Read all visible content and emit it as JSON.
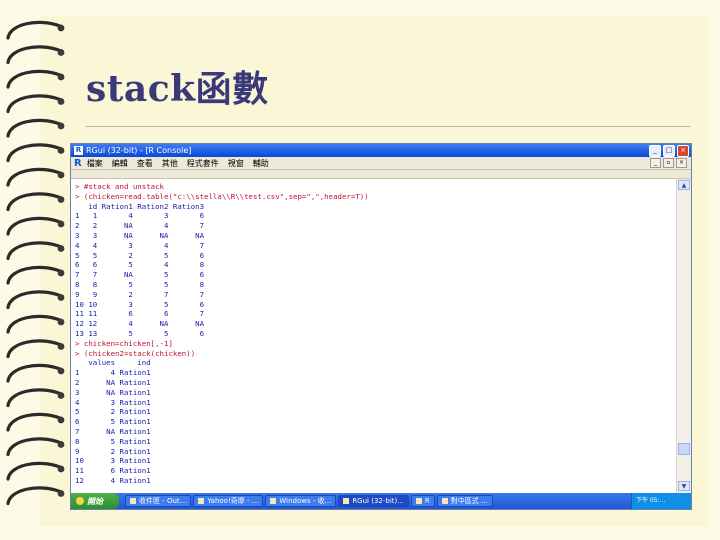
{
  "slide": {
    "title": "stack函數"
  },
  "window": {
    "title": "RGui (32-bit) - [R Console]",
    "menu": [
      "檔案",
      "編輯",
      "查看",
      "其他",
      "程式套件",
      "視窗",
      "輔助"
    ]
  },
  "console": {
    "lines": [
      {
        "t": "cmd",
        "s": "> #stack and unstack"
      },
      {
        "t": "cmd",
        "s": "> (chicken=read.table(\"c:\\\\stella\\\\R\\\\test.csv\",sep=\",\",header=T))"
      },
      {
        "t": "out",
        "s": "   id Ration1 Ration2 Ration3"
      },
      {
        "t": "out",
        "s": "1   1       4       3       6"
      },
      {
        "t": "out",
        "s": "2   2      NA       4       7"
      },
      {
        "t": "out",
        "s": "3   3      NA      NA      NA"
      },
      {
        "t": "out",
        "s": "4   4       3       4       7"
      },
      {
        "t": "out",
        "s": "5   5       2       5       6"
      },
      {
        "t": "out",
        "s": "6   6       5       4       8"
      },
      {
        "t": "out",
        "s": "7   7      NA       5       6"
      },
      {
        "t": "out",
        "s": "8   8       5       5       8"
      },
      {
        "t": "out",
        "s": "9   9       2       7       7"
      },
      {
        "t": "out",
        "s": "10 10       3       5       6"
      },
      {
        "t": "out",
        "s": "11 11       6       6       7"
      },
      {
        "t": "out",
        "s": "12 12       4      NA      NA"
      },
      {
        "t": "out",
        "s": "13 13       5       5       6"
      },
      {
        "t": "cmd",
        "s": "> chicken=chicken[,-1]"
      },
      {
        "t": "cmd",
        "s": "> (chicken2=stack(chicken))"
      },
      {
        "t": "out",
        "s": "   values     ind"
      },
      {
        "t": "out",
        "s": "1       4 Ration1"
      },
      {
        "t": "out",
        "s": "2      NA Ration1"
      },
      {
        "t": "out",
        "s": "3      NA Ration1"
      },
      {
        "t": "out",
        "s": "4       3 Ration1"
      },
      {
        "t": "out",
        "s": "5       2 Ration1"
      },
      {
        "t": "out",
        "s": "6       5 Ration1"
      },
      {
        "t": "out",
        "s": "7      NA Ration1"
      },
      {
        "t": "out",
        "s": "8       5 Ration1"
      },
      {
        "t": "out",
        "s": "9       2 Ration1"
      },
      {
        "t": "out",
        "s": "10      3 Ration1"
      },
      {
        "t": "out",
        "s": "11      6 Ration1"
      },
      {
        "t": "out",
        "s": "12      4 Ration1"
      }
    ]
  },
  "taskbar": {
    "start": "開始",
    "tasks": [
      "收件匣 - Out...",
      "Yahoo!奇摩 - ...",
      "Windows - 收...",
      "RGui (32-bit)...",
      "R",
      "對中區式 ..."
    ],
    "tray": "下午 05:..."
  }
}
